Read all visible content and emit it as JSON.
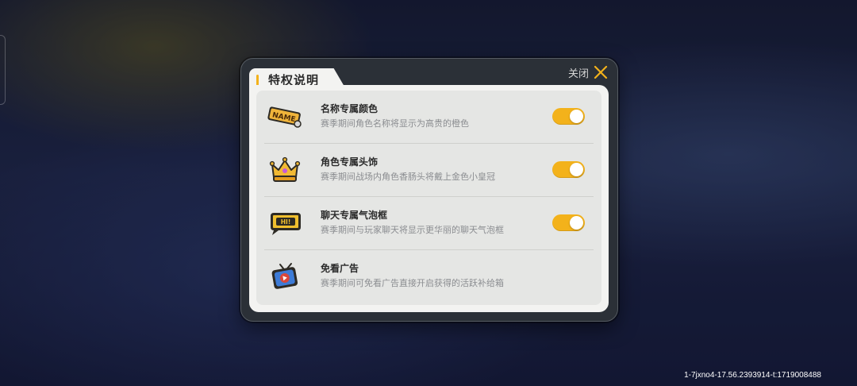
{
  "dialog": {
    "title": "特权说明",
    "close_label": "关闭"
  },
  "privileges": [
    {
      "name": "名称专属颜色",
      "description": "赛季期间角色名称将显示为高贵的橙色",
      "icon": "name-tag-icon",
      "icon_text": "NAME",
      "has_toggle": true,
      "enabled": true
    },
    {
      "name": "角色专属头饰",
      "description": "赛季期间战场内角色香肠头将戴上金色小皇冠",
      "icon": "crown-icon",
      "has_toggle": true,
      "enabled": true
    },
    {
      "name": "聊天专属气泡框",
      "description": "赛季期间与玩家聊天将显示更华丽的聊天气泡框",
      "icon": "chat-bubble-icon",
      "icon_text": "HI!",
      "has_toggle": true,
      "enabled": true
    },
    {
      "name": "免看广告",
      "description": "赛季期间可免看广告直接开启获得的活跃补给箱",
      "icon": "ad-tv-icon",
      "has_toggle": false
    }
  ],
  "watermark": "1-7jxno4-17.56.2393914-t:1719008488",
  "colors": {
    "accent": "#f3b21b",
    "panel": "#2b3037",
    "card": "#f3f3f1",
    "list": "#e5e6e4"
  }
}
